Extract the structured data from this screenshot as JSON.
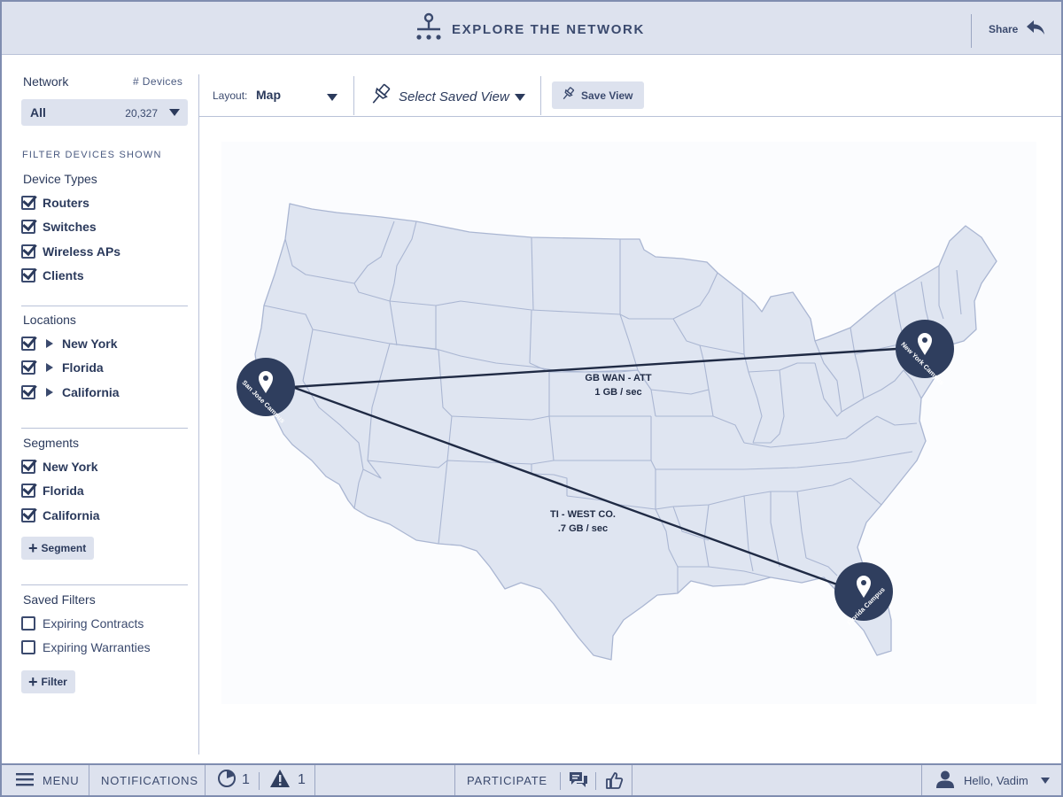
{
  "header": {
    "title": "EXPLORE THE NETWORK",
    "share_label": "Share",
    "icons": {
      "logo": "network-hierarchy-icon",
      "share": "reply-arrow-icon"
    }
  },
  "sidebar": {
    "network_label": "Network",
    "devices_label": "# Devices",
    "network_select": {
      "value": "All",
      "count": "20,327"
    },
    "filter_heading": "FILTER DEVICES SHOWN",
    "device_types": {
      "title": "Device Types",
      "items": [
        {
          "label": "Routers",
          "checked": true
        },
        {
          "label": "Switches",
          "checked": true
        },
        {
          "label": "Wireless APs",
          "checked": true
        },
        {
          "label": "Clients",
          "checked": true
        }
      ]
    },
    "locations": {
      "title": "Locations",
      "items": [
        {
          "label": "New York",
          "checked": true
        },
        {
          "label": "Florida",
          "checked": true
        },
        {
          "label": "California",
          "checked": true
        }
      ]
    },
    "segments": {
      "title": "Segments",
      "items": [
        {
          "label": "New York",
          "checked": true
        },
        {
          "label": "Florida",
          "checked": true
        },
        {
          "label": "California",
          "checked": true
        }
      ],
      "add_label": "Segment"
    },
    "saved_filters": {
      "title": "Saved Filters",
      "items": [
        {
          "label": "Expiring Contracts",
          "checked": false
        },
        {
          "label": "Expiring Warranties",
          "checked": false
        }
      ],
      "add_label": "Filter"
    }
  },
  "toolbar": {
    "layout_label": "Layout:",
    "layout_value": "Map",
    "saved_view_label": "Select Saved View",
    "save_view_label": "Save View"
  },
  "map": {
    "campuses": [
      {
        "name": "San Jose Campus"
      },
      {
        "name": "New York Campus"
      },
      {
        "name": "Florida Campus"
      }
    ],
    "links": [
      {
        "name": "GB WAN - ATT",
        "rate": "1 GB / sec"
      },
      {
        "name": "TI - WEST CO.",
        "rate": ".7 GB / sec"
      }
    ],
    "colors": {
      "land": "#dfe5f1",
      "state_border": "#aab6d2",
      "marker": "#2f3e5e",
      "link": "#1f2a44"
    }
  },
  "footer": {
    "menu_label": "MENU",
    "notifications_label": "NOTIFICATIONS",
    "pie_count": "1",
    "alert_count": "1",
    "participate_label": "PARTICIPATE",
    "greeting": "Hello, Vadim"
  }
}
